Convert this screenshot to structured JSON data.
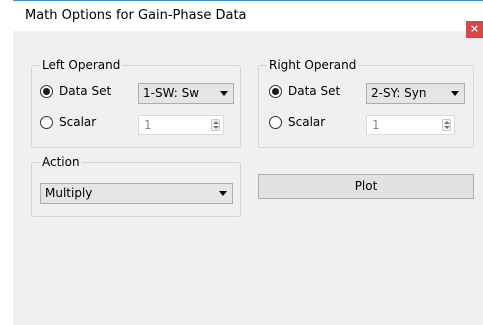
{
  "window": {
    "title": "Math Options for Gain-Phase Data",
    "close_label": "×"
  },
  "left_operand": {
    "legend": "Left Operand",
    "data_set_label": "Data Set",
    "data_set_selected": true,
    "data_set_value": "1-SW: Sw",
    "scalar_label": "Scalar",
    "scalar_selected": false,
    "scalar_value": "1"
  },
  "right_operand": {
    "legend": "Right Operand",
    "data_set_label": "Data Set",
    "data_set_selected": true,
    "data_set_value": "2-SY: Syn",
    "scalar_label": "Scalar",
    "scalar_selected": false,
    "scalar_value": "1"
  },
  "action": {
    "legend": "Action",
    "selected": "Multiply"
  },
  "plot_button": {
    "label": "Plot"
  }
}
